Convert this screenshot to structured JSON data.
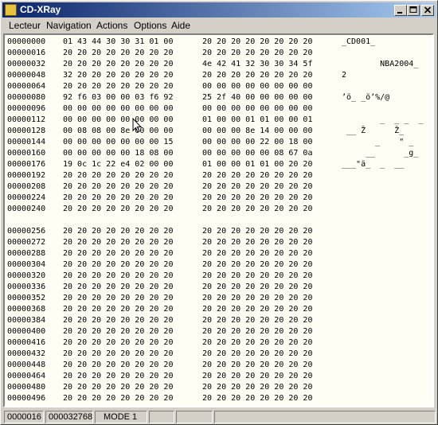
{
  "window": {
    "title": "CD-XRay"
  },
  "menu": [
    "Lecteur",
    "Navigation",
    "Actions",
    "Options",
    "Aide"
  ],
  "dump": [
    {
      "off": "00000000",
      "hex1": "01 43 44 30 30 31 01 00",
      "hex2": "20 20 20 20 20 20 20 20",
      "ascii": "_CD001_"
    },
    {
      "off": "00000016",
      "hex1": "20 20 20 20 20 20 20 20",
      "hex2": "20 20 20 20 20 20 20 20",
      "ascii": ""
    },
    {
      "off": "00000032",
      "hex1": "20 20 20 20 20 20 20 20",
      "hex2": "4e 42 41 32 30 30 34 5f",
      "ascii": "        NBA2004_"
    },
    {
      "off": "00000048",
      "hex1": "32 20 20 20 20 20 20 20",
      "hex2": "20 20 20 20 20 20 20 20",
      "ascii": "2"
    },
    {
      "off": "00000064",
      "hex1": "20 20 20 20 20 20 20 20",
      "hex2": "00 00 00 00 00 00 00 00",
      "ascii": ""
    },
    {
      "off": "00000080",
      "hex1": "92 f6 03 00 00 03 f6 92",
      "hex2": "25 2f 40 00 00 00 00 00",
      "ascii": "’ö_ _ö’%/@"
    },
    {
      "off": "00000096",
      "hex1": "00 00 00 00 00 00 00 00",
      "hex2": "00 00 00 00 00 00 00 00",
      "ascii": ""
    },
    {
      "off": "00000112",
      "hex1": "00 00 00 00 00 00 00 00",
      "hex2": "01 00 00 01 01 00 00 01",
      "ascii": "        _  _ _  _"
    },
    {
      "off": "00000128",
      "hex1": "00 08 08 00 8e 00 00 00",
      "hex2": "00 00 00 8e 14 00 00 00",
      "ascii": " __ Ž      Ž_"
    },
    {
      "off": "00000144",
      "hex1": "00 00 00 00 00 00 00 15",
      "hex2": "00 00 00 00 22 00 18 00",
      "ascii": "       _    \" _"
    },
    {
      "off": "00000160",
      "hex1": "00 00 00 00 00 18 08 00",
      "hex2": "00 00 00 00 00 08 67 0a",
      "ascii": "     __      _g_"
    },
    {
      "off": "00000176",
      "hex1": "19 0c 1c 22 e4 02 00 00",
      "hex2": "01 00 00 01 01 00 20 20",
      "ascii": "___\"ä_  _  __"
    },
    {
      "off": "00000192",
      "hex1": "20 20 20 20 20 20 20 20",
      "hex2": "20 20 20 20 20 20 20 20",
      "ascii": ""
    },
    {
      "off": "00000208",
      "hex1": "20 20 20 20 20 20 20 20",
      "hex2": "20 20 20 20 20 20 20 20",
      "ascii": ""
    },
    {
      "off": "00000224",
      "hex1": "20 20 20 20 20 20 20 20",
      "hex2": "20 20 20 20 20 20 20 20",
      "ascii": ""
    },
    {
      "off": "00000240",
      "hex1": "20 20 20 20 20 20 20 20",
      "hex2": "20 20 20 20 20 20 20 20",
      "ascii": ""
    },
    {
      "off": "00000256",
      "hex1": "20 20 20 20 20 20 20 20",
      "hex2": "20 20 20 20 20 20 20 20",
      "ascii": ""
    },
    {
      "off": "00000272",
      "hex1": "20 20 20 20 20 20 20 20",
      "hex2": "20 20 20 20 20 20 20 20",
      "ascii": ""
    },
    {
      "off": "00000288",
      "hex1": "20 20 20 20 20 20 20 20",
      "hex2": "20 20 20 20 20 20 20 20",
      "ascii": ""
    },
    {
      "off": "00000304",
      "hex1": "20 20 20 20 20 20 20 20",
      "hex2": "20 20 20 20 20 20 20 20",
      "ascii": ""
    },
    {
      "off": "00000320",
      "hex1": "20 20 20 20 20 20 20 20",
      "hex2": "20 20 20 20 20 20 20 20",
      "ascii": ""
    },
    {
      "off": "00000336",
      "hex1": "20 20 20 20 20 20 20 20",
      "hex2": "20 20 20 20 20 20 20 20",
      "ascii": ""
    },
    {
      "off": "00000352",
      "hex1": "20 20 20 20 20 20 20 20",
      "hex2": "20 20 20 20 20 20 20 20",
      "ascii": ""
    },
    {
      "off": "00000368",
      "hex1": "20 20 20 20 20 20 20 20",
      "hex2": "20 20 20 20 20 20 20 20",
      "ascii": ""
    },
    {
      "off": "00000384",
      "hex1": "20 20 20 20 20 20 20 20",
      "hex2": "20 20 20 20 20 20 20 20",
      "ascii": ""
    },
    {
      "off": "00000400",
      "hex1": "20 20 20 20 20 20 20 20",
      "hex2": "20 20 20 20 20 20 20 20",
      "ascii": ""
    },
    {
      "off": "00000416",
      "hex1": "20 20 20 20 20 20 20 20",
      "hex2": "20 20 20 20 20 20 20 20",
      "ascii": ""
    },
    {
      "off": "00000432",
      "hex1": "20 20 20 20 20 20 20 20",
      "hex2": "20 20 20 20 20 20 20 20",
      "ascii": ""
    },
    {
      "off": "00000448",
      "hex1": "20 20 20 20 20 20 20 20",
      "hex2": "20 20 20 20 20 20 20 20",
      "ascii": ""
    },
    {
      "off": "00000464",
      "hex1": "20 20 20 20 20 20 20 20",
      "hex2": "20 20 20 20 20 20 20 20",
      "ascii": ""
    },
    {
      "off": "00000480",
      "hex1": "20 20 20 20 20 20 20 20",
      "hex2": "20 20 20 20 20 20 20 20",
      "ascii": ""
    },
    {
      "off": "00000496",
      "hex1": "20 20 20 20 20 20 20 20",
      "hex2": "20 20 20 20 20 20 20 20",
      "ascii": ""
    }
  ],
  "status": {
    "offset": "0000016",
    "size": "000032768",
    "mode": "MODE 1",
    "field4": "",
    "field5": "",
    "field6": ""
  },
  "icons": {
    "app": "cdrom-icon",
    "minimize": "minimize-icon",
    "maximize": "maximize-icon",
    "close": "close-icon",
    "cursor": "mouse-pointer-icon"
  },
  "colors": {
    "title_start": "#0a246a",
    "title_end": "#a6caf0",
    "content_bg": "#fffef5",
    "chrome": "#d4d0c8"
  }
}
